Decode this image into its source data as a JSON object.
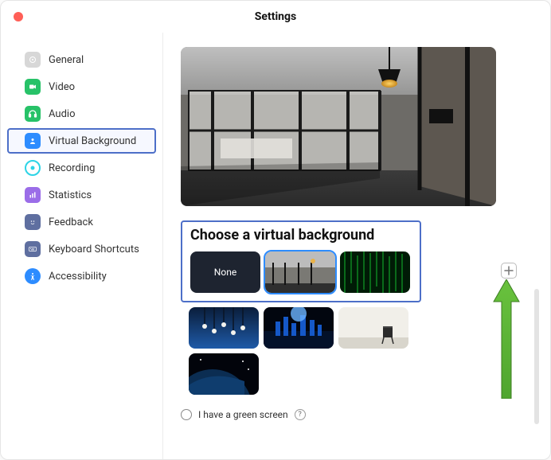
{
  "window": {
    "title": "Settings"
  },
  "sidebar": {
    "items": [
      {
        "label": "General",
        "icon": "gear-icon",
        "color": "#d0d0d0"
      },
      {
        "label": "Video",
        "icon": "video-icon",
        "color": "#2ecc71"
      },
      {
        "label": "Audio",
        "icon": "headphones-icon",
        "color": "#2ecc71"
      },
      {
        "label": "Virtual Background",
        "icon": "person-frame-icon",
        "color": "#2d8cff",
        "selected": true
      },
      {
        "label": "Recording",
        "icon": "record-icon",
        "color": "#2dd4e6"
      },
      {
        "label": "Statistics",
        "icon": "stats-icon",
        "color": "#9b6de8"
      },
      {
        "label": "Feedback",
        "icon": "face-icon",
        "color": "#5f6fa0"
      },
      {
        "label": "Keyboard Shortcuts",
        "icon": "keyboard-icon",
        "color": "#5f6fa0"
      },
      {
        "label": "Accessibility",
        "icon": "accessibility-icon",
        "color": "#2d8cff"
      }
    ]
  },
  "main": {
    "choose_title": "Choose a virtual background",
    "thumbs": {
      "none_label": "None",
      "items": [
        {
          "name": "none",
          "selected": false
        },
        {
          "name": "office-glass",
          "selected": true
        },
        {
          "name": "matrix-code",
          "selected": false
        },
        {
          "name": "hanging-bulbs",
          "selected": false
        },
        {
          "name": "city-night",
          "selected": false
        },
        {
          "name": "empty-room-chair",
          "selected": false
        },
        {
          "name": "earth-space",
          "selected": false
        }
      ]
    },
    "green_screen_label": "I have a green screen"
  }
}
